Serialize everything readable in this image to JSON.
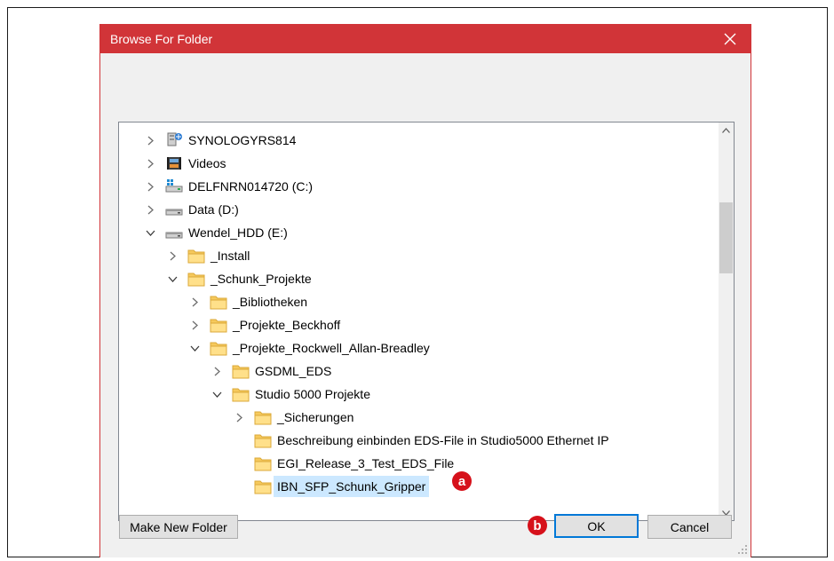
{
  "dialog": {
    "title": "Browse For Folder",
    "close_glyph": "✕"
  },
  "tree": {
    "items": [
      {
        "label": "SYNOLOGYRS814",
        "icon": "network-drive-icon",
        "expander": "collapsed",
        "level": 0
      },
      {
        "label": "Videos",
        "icon": "videos-folder-icon",
        "expander": "collapsed",
        "level": 0
      },
      {
        "label": "DELFNRN014720 (C:)",
        "icon": "windows-drive-icon",
        "expander": "collapsed",
        "level": 0
      },
      {
        "label": "Data (D:)",
        "icon": "drive-icon",
        "expander": "collapsed",
        "level": 0
      },
      {
        "label": "Wendel_HDD (E:)",
        "icon": "drive-icon",
        "expander": "expanded",
        "level": 0
      },
      {
        "label": "_Install",
        "icon": "folder-icon",
        "expander": "collapsed",
        "level": 1
      },
      {
        "label": "_Schunk_Projekte",
        "icon": "folder-icon",
        "expander": "expanded",
        "level": 1
      },
      {
        "label": "_Bibliotheken",
        "icon": "folder-icon",
        "expander": "collapsed",
        "level": 2
      },
      {
        "label": "_Projekte_Beckhoff",
        "icon": "folder-icon",
        "expander": "collapsed",
        "level": 2
      },
      {
        "label": "_Projekte_Rockwell_Allan-Breadley",
        "icon": "folder-icon",
        "expander": "expanded",
        "level": 2
      },
      {
        "label": "GSDML_EDS",
        "icon": "folder-icon",
        "expander": "collapsed",
        "level": 3
      },
      {
        "label": "Studio 5000 Projekte",
        "icon": "folder-icon",
        "expander": "expanded",
        "level": 3
      },
      {
        "label": "_Sicherungen",
        "icon": "folder-icon",
        "expander": "collapsed",
        "level": 4
      },
      {
        "label": "Beschreibung einbinden EDS-File in Studio5000 Ethernet IP",
        "icon": "folder-icon",
        "expander": "none",
        "level": 4
      },
      {
        "label": "EGI_Release_3_Test_EDS_File",
        "icon": "folder-icon",
        "expander": "none",
        "level": 4
      },
      {
        "label": "IBN_SFP_Schunk_Gripper",
        "icon": "folder-icon",
        "expander": "none",
        "level": 4,
        "selected": true
      }
    ]
  },
  "buttons": {
    "make_new_folder": "Make New Folder",
    "ok": "OK",
    "cancel": "Cancel"
  },
  "markers": {
    "a": "a",
    "b": "b"
  },
  "colors": {
    "title_bar": "#d13438",
    "selection": "#cce8ff",
    "marker": "#d6111b",
    "default_button_border": "#0078d7"
  }
}
